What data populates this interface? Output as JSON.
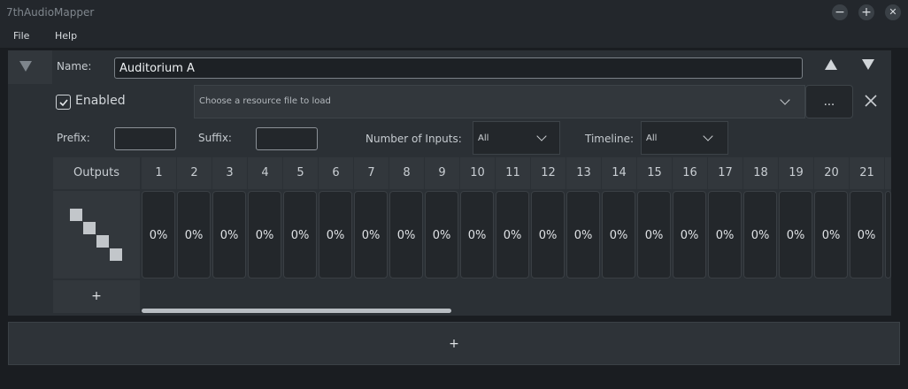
{
  "window": {
    "title": "7thAudioMapper",
    "minimize_glyph": "−",
    "maximize_glyph": "+",
    "close_glyph": "✕"
  },
  "menu": {
    "items": [
      "File",
      "Help"
    ]
  },
  "mapping": {
    "name_label": "Name:",
    "name_value": "Auditorium A",
    "enabled_label": "Enabled",
    "enabled": true,
    "resource_placeholder": "Choose a resource file to load",
    "browse_label": "...",
    "prefix_label": "Prefix:",
    "prefix_value": "",
    "suffix_label": "Suffix:",
    "suffix_value": "",
    "inputs_label": "Number of Inputs:",
    "inputs_value": "All",
    "timeline_label": "Timeline:",
    "timeline_value": "All"
  },
  "grid": {
    "outputs_header": "Outputs",
    "columns": [
      "1",
      "2",
      "3",
      "4",
      "5",
      "6",
      "7",
      "8",
      "9",
      "10",
      "11",
      "12",
      "13",
      "14",
      "15",
      "16",
      "17",
      "18",
      "19",
      "20",
      "21"
    ],
    "values": [
      "0%",
      "0%",
      "0%",
      "0%",
      "0%",
      "0%",
      "0%",
      "0%",
      "0%",
      "0%",
      "0%",
      "0%",
      "0%",
      "0%",
      "0%",
      "0%",
      "0%",
      "0%",
      "0%",
      "0%",
      "0%"
    ],
    "add_output_label": "+"
  },
  "add_mapping_label": "+",
  "icons": {
    "collapse": "triangle-down-icon",
    "move_up": "triangle-up-icon",
    "move_down": "triangle-down-icon",
    "remove": "close-icon",
    "output_matrix": "diagonal-matrix-icon"
  },
  "colors": {
    "background": "#1a1d21",
    "panel": "#2b3035",
    "header_cell": "#32373c",
    "cell": "#23272b",
    "text": "#d2d6da"
  }
}
